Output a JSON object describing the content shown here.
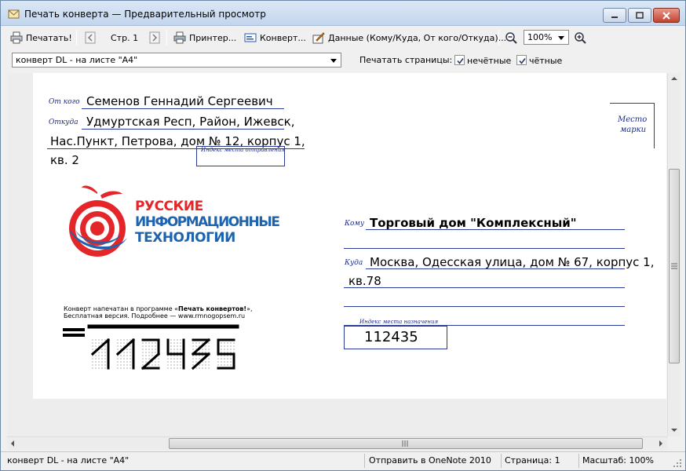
{
  "window": {
    "title": "Печать конверта — Предварительный просмотр"
  },
  "toolbar": {
    "print_label": "Печатать!",
    "page_label": "Стр. 1",
    "printer_label": "Принтер...",
    "envelope_label": "Конверт...",
    "data_label": "Данные (Кому/Куда, От кого/Откуда)...",
    "zoom_value": "100%"
  },
  "row2": {
    "envelope_select": "конверт DL - на листе \"A4\"",
    "print_pages_label": "Печатать страницы:",
    "odd_label": "нечётные",
    "even_label": "чётные",
    "odd_checked": true,
    "even_checked": true
  },
  "envelope": {
    "from_label": "От кого",
    "from_value": "Семенов Геннадий Сергеевич",
    "from_where_label": "Откуда",
    "from_where_line1": "Удмуртская Респ, Район, Ижевск,",
    "from_where_line2": "Нас.Пункт, Петрова, дом № 12, корпус 1,",
    "from_where_line3": "кв. 2",
    "sender_index_label": "Индекс места отправления",
    "stamp_line1": "Место",
    "stamp_line2": "марки",
    "to_label": "Кому",
    "to_value": "Торговый дом \"Комплексный\"",
    "to_where_label": "Куда",
    "to_where_line1": "Москва, Одесская улица, дом № 67, корпус 1,",
    "to_where_line2": "кв.78",
    "dest_index_label": "Индекс места назначения",
    "dest_index_value": "112435",
    "logo_line1": "РУССКИЕ",
    "logo_line2": "ИНФОРМАЦИОННЫЕ",
    "logo_line3": "ТЕХНОЛОГИИ",
    "promo_line1a": "Конверт напечатан в программе «",
    "promo_line1b": "Печать конвертов!",
    "promo_line1c": "»,",
    "promo_line2": "Бесплатная версия. Подробнее — www.rmnogopsem.ru",
    "postal_code_digits": "112435"
  },
  "status": {
    "left": "конверт DL - на листе \"A4\"",
    "onenote": "Отправить в OneNote 2010",
    "page": "Страница: 1",
    "zoom": "Масштаб: 100%"
  },
  "colors": {
    "accent": "#2c3c9a",
    "logo_red": "#e4262a",
    "logo_blue": "#1e63ad"
  }
}
